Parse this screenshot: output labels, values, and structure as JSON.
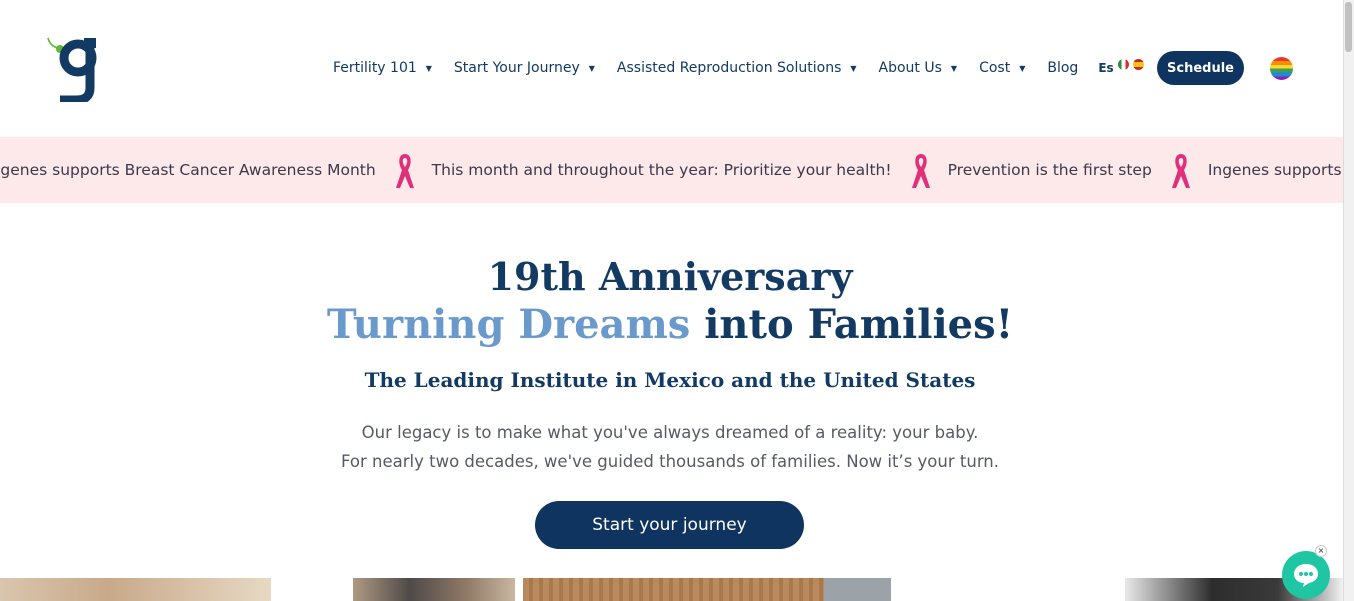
{
  "header": {
    "nav": [
      {
        "label": "Fertility 101",
        "has_dropdown": true
      },
      {
        "label": "Start Your Journey",
        "has_dropdown": true
      },
      {
        "label": "Assisted Reproduction Solutions",
        "has_dropdown": true
      },
      {
        "label": "About Us",
        "has_dropdown": true
      },
      {
        "label": "Cost",
        "has_dropdown": true
      },
      {
        "label": "Blog",
        "has_dropdown": false
      }
    ],
    "language": "Es",
    "schedule_label": "Schedule",
    "caret": "▼"
  },
  "banner": {
    "messages": [
      "Ingenes supports Breast Cancer Awareness Month",
      "This month and throughout the year: Prioritize your health!",
      "Prevention is the first step",
      "Ingenes supports Breast Cancer Awareness Month"
    ],
    "ribbon_color": "#e0307a",
    "background": "#fde8ea"
  },
  "hero": {
    "title_line1": "19th Anniversary",
    "title_line2_accent": "Turning Dreams",
    "title_line2_rest": " into Families!",
    "subtitle": "The Leading Institute in Mexico and the United States",
    "paragraph_line1": "Our legacy is to make what you've always dreamed of a reality: your baby.",
    "paragraph_line2": "For nearly two decades, we've guided thousands of families. Now it’s your turn.",
    "cta_label": "Start your journey"
  },
  "chat": {
    "close_label": "×"
  },
  "colors": {
    "brand_navy": "#0f3460",
    "accent_blue": "#6a9acb",
    "chat_green": "#1fc6a3"
  }
}
